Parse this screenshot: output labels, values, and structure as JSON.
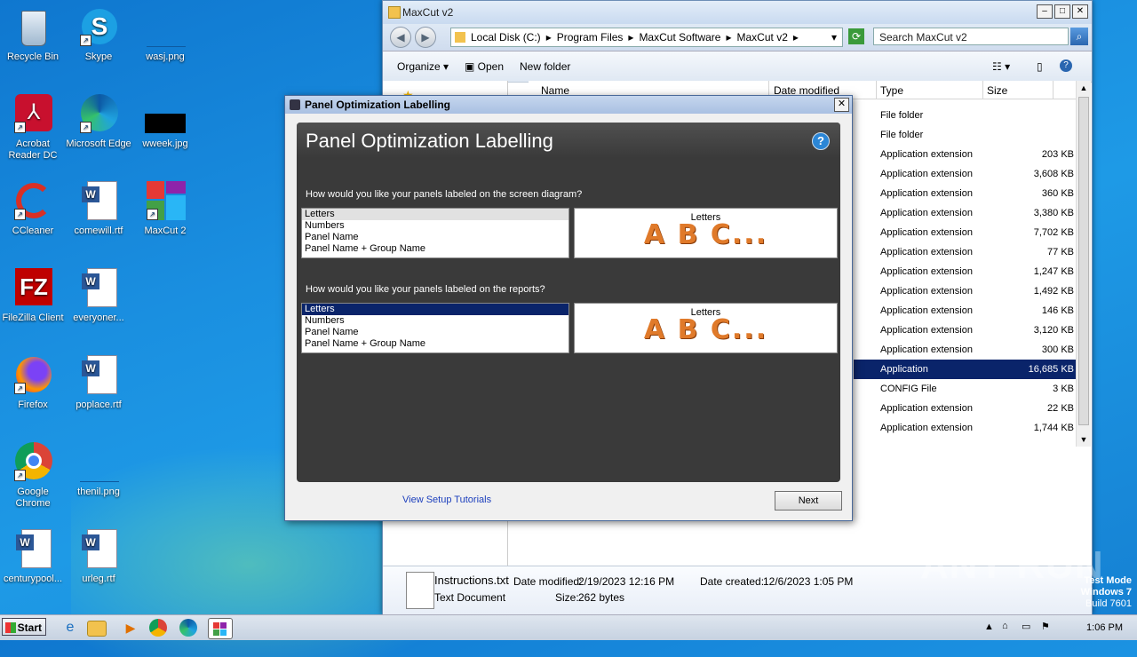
{
  "desktop": {
    "icons": [
      {
        "label": "Recycle Bin"
      },
      {
        "label": "Skype"
      },
      {
        "label": "wasj.png"
      },
      {
        "label": "Acrobat Reader DC"
      },
      {
        "label": "Microsoft Edge"
      },
      {
        "label": "wweek.jpg"
      },
      {
        "label": "CCleaner"
      },
      {
        "label": "comewill.rtf"
      },
      {
        "label": "MaxCut 2"
      },
      {
        "label": "FileZilla Client"
      },
      {
        "label": "everyoner..."
      },
      {
        "label": "Firefox"
      },
      {
        "label": "poplace.rtf"
      },
      {
        "label": "Google Chrome"
      },
      {
        "label": "thenil.png"
      },
      {
        "label": "centurypool..."
      },
      {
        "label": "urleg.rtf"
      }
    ],
    "watermark": "ANY RUN",
    "test_mode": {
      "line1": "Test Mode",
      "line2": "Windows 7",
      "line3": "Build 7601"
    }
  },
  "explorer": {
    "title": "MaxCut v2",
    "address": [
      "Local Disk (C:)",
      "Program Files",
      "MaxCut Software",
      "MaxCut v2"
    ],
    "search_placeholder": "Search MaxCut v2",
    "toolbar": {
      "organize": "Organize",
      "open": "Open",
      "new_folder": "New folder"
    },
    "columns": {
      "name": "Name",
      "date": "Date modified",
      "type": "Type",
      "size": "Size"
    },
    "rows": [
      {
        "type": "File folder",
        "size": ""
      },
      {
        "type": "File folder",
        "size": ""
      },
      {
        "type": "Application extension",
        "size": "203 KB"
      },
      {
        "type": "Application extension",
        "size": "3,608 KB"
      },
      {
        "type": "Application extension",
        "size": "360 KB"
      },
      {
        "type": "Application extension",
        "size": "3,380 KB"
      },
      {
        "type": "Application extension",
        "size": "7,702 KB"
      },
      {
        "type": "Application extension",
        "size": "77 KB"
      },
      {
        "type": "Application extension",
        "size": "1,247 KB"
      },
      {
        "type": "Application extension",
        "size": "1,492 KB"
      },
      {
        "type": "Application extension",
        "size": "146 KB"
      },
      {
        "type": "Application extension",
        "size": "3,120 KB"
      },
      {
        "type": "Application extension",
        "size": "300 KB"
      },
      {
        "type": "Application",
        "size": "16,685 KB",
        "selected": true
      },
      {
        "type": "CONFIG File",
        "size": "3 KB"
      },
      {
        "type": "Application extension",
        "size": "22 KB"
      },
      {
        "type": "Application extension",
        "size": "1,744 KB"
      }
    ],
    "details": {
      "filename": "Instructions.txt",
      "filetype": "Text Document",
      "modified_label": "Date modified:",
      "modified": "2/19/2023 12:16 PM",
      "created_label": "Date created:",
      "created": "12/6/2023 1:05 PM",
      "size_label": "Size:",
      "size": "262 bytes"
    }
  },
  "dialog": {
    "window_title": "Panel Optimization Labelling",
    "header": "Panel Optimization Labelling",
    "question1": "How would you like your panels labeled on the screen diagram?",
    "question2": "How would you like your panels labeled on the reports?",
    "options": [
      "Letters",
      "Numbers",
      "Panel Name",
      "Panel Name + Group Name"
    ],
    "preview_caption": "Letters",
    "preview_text": "A B C...",
    "link": "View Setup Tutorials",
    "next": "Next"
  },
  "taskbar": {
    "start": "Start",
    "clock": "1:06 PM"
  }
}
